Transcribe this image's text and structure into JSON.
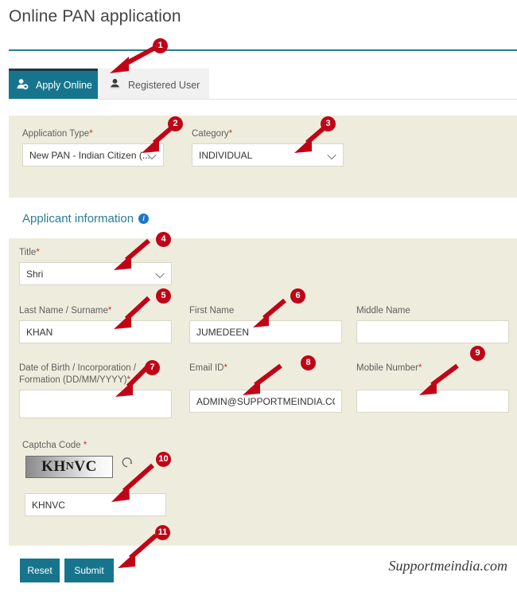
{
  "page": {
    "title": "Online PAN application",
    "watermark": "Supportmeindia.com",
    "accent_color": "#16758d",
    "panel_color": "#eeeddd",
    "callout_color": "#c00418"
  },
  "tabs": [
    {
      "label": "Apply Online",
      "icon": "user-add-icon",
      "active": true
    },
    {
      "label": "Registered User",
      "icon": "user-icon",
      "active": false
    }
  ],
  "application_section": {
    "fields": [
      {
        "label": "Application Type",
        "required": true,
        "type": "select",
        "value": "New PAN - Indian Citizen (..."
      },
      {
        "label": "Category",
        "required": true,
        "type": "select",
        "value": "INDIVIDUAL"
      }
    ]
  },
  "applicant_section": {
    "heading": "Applicant information",
    "info_icon": "info-icon",
    "fields": [
      {
        "label": "Title",
        "required": true,
        "type": "select",
        "value": "Shri"
      },
      {
        "label": "Last Name / Surname",
        "required": true,
        "type": "text",
        "value": "KHAN"
      },
      {
        "label": "First Name",
        "required": false,
        "type": "text",
        "value": "JUMEDEEN"
      },
      {
        "label": "Middle Name",
        "required": false,
        "type": "text",
        "value": ""
      },
      {
        "label": "Date of Birth / Incorporation /\nFormation (DD/MM/YYYY)",
        "label_line1": "Date of Birth / Incorporation /",
        "label_line2": "Formation (DD/MM/YYYY)",
        "required": true,
        "type": "text",
        "value": ""
      },
      {
        "label": "Email ID",
        "required": true,
        "type": "text",
        "value": "ADMIN@SUPPORTMEINDIA.CO"
      },
      {
        "label": "Mobile Number",
        "required": true,
        "type": "text",
        "value": ""
      }
    ],
    "captcha": {
      "label": "Captcha Code",
      "required": true,
      "image_text": "KHNVC",
      "image_text_part1": "KH",
      "image_text_part2": "N",
      "image_text_part3": "VC",
      "refresh_icon": "refresh-icon",
      "input_value": "KHNVC"
    }
  },
  "actions": {
    "reset_label": "Reset",
    "submit_label": "Submit"
  },
  "callouts": [
    {
      "number": "1"
    },
    {
      "number": "2"
    },
    {
      "number": "3"
    },
    {
      "number": "4"
    },
    {
      "number": "5"
    },
    {
      "number": "6"
    },
    {
      "number": "7"
    },
    {
      "number": "8"
    },
    {
      "number": "9"
    },
    {
      "number": "10"
    },
    {
      "number": "11"
    }
  ]
}
